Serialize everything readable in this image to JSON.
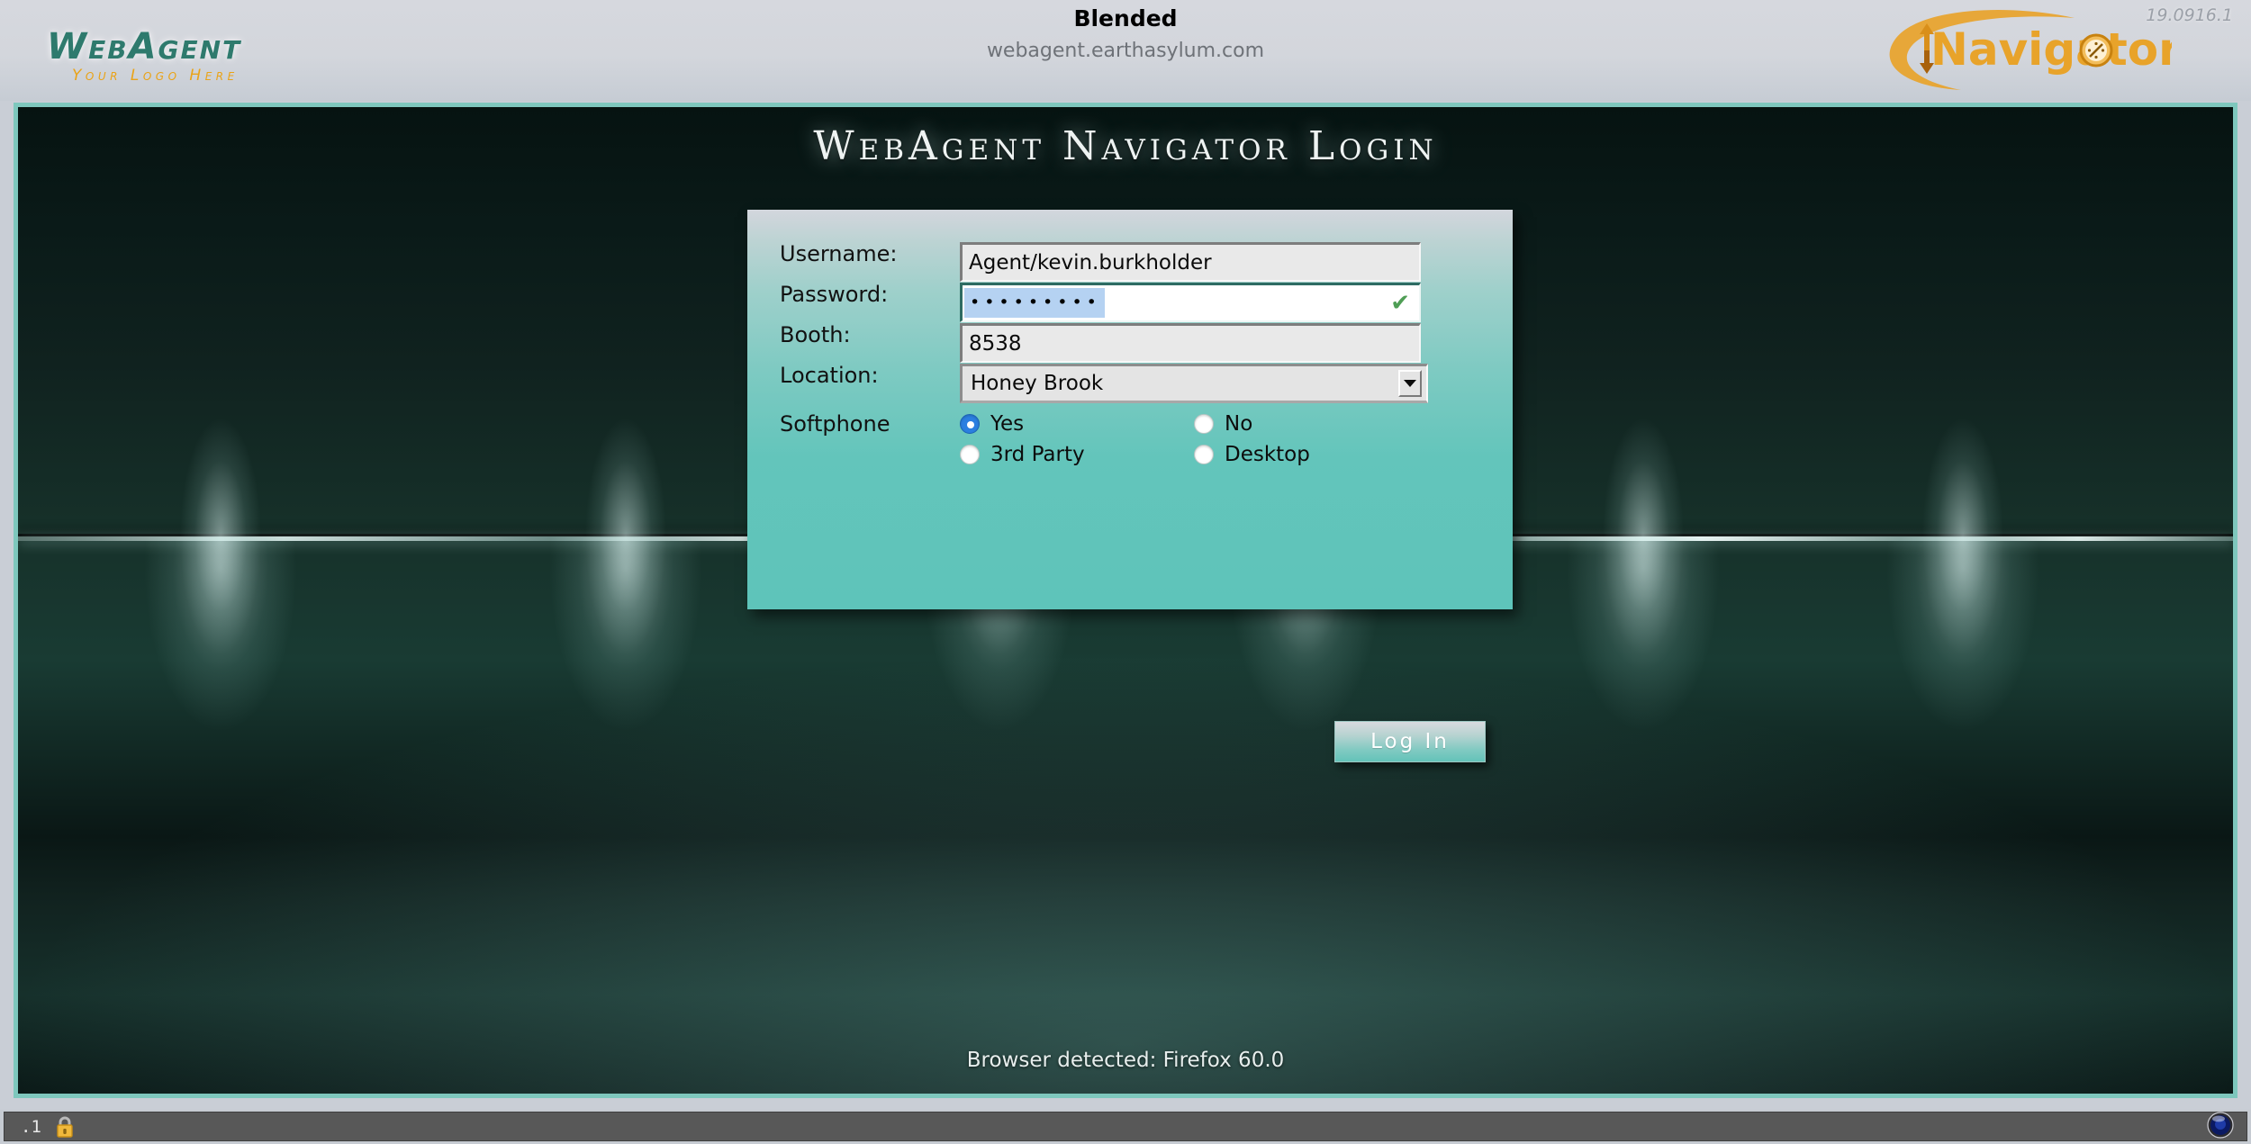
{
  "header": {
    "logo_main": "WebAgent",
    "logo_sub": "Your Logo Here",
    "app_mode": "Blended",
    "app_host": "webagent.earthasylum.com",
    "nav_logo_text": "Navigator",
    "version": "19.0916.1",
    "colors": {
      "logo_teal": "#2e7a6d",
      "logo_orange": "#eaa317",
      "nav_orange": "#e8a32a",
      "header_bg": "#d3d6dc"
    }
  },
  "login": {
    "title": "WebAgent Navigator Login",
    "fields": {
      "username": {
        "label": "Username:",
        "value": "Agent/kevin.burkholder",
        "placeholder": ""
      },
      "password": {
        "label": "Password:",
        "value": "•••••••••",
        "masked_length": 9,
        "valid_icon": "check-icon",
        "placeholder": ""
      },
      "booth": {
        "label": "Booth:",
        "value": "8538",
        "placeholder": ""
      },
      "location": {
        "label": "Location:",
        "value": "Honey Brook",
        "options": [
          "Honey Brook"
        ]
      }
    },
    "softphone": {
      "label": "Softphone",
      "options": [
        {
          "label": "Yes",
          "checked": true
        },
        {
          "label": "No",
          "checked": false
        },
        {
          "label": "3rd Party",
          "checked": false
        },
        {
          "label": "Desktop",
          "checked": false
        }
      ]
    },
    "submit_label": "Log In",
    "browser_detected": "Browser detected: Firefox 60.0",
    "colors": {
      "panel_teal": "#5ec4ba",
      "accent_check": "#4f9e55",
      "radio_selected": "#2b7fe0",
      "selection_blue": "#b5d2f2"
    }
  },
  "status_bar": {
    "zoom_level": ".1",
    "lock_icon": "padlock-icon",
    "orb_icon": "blue-orb-icon"
  }
}
